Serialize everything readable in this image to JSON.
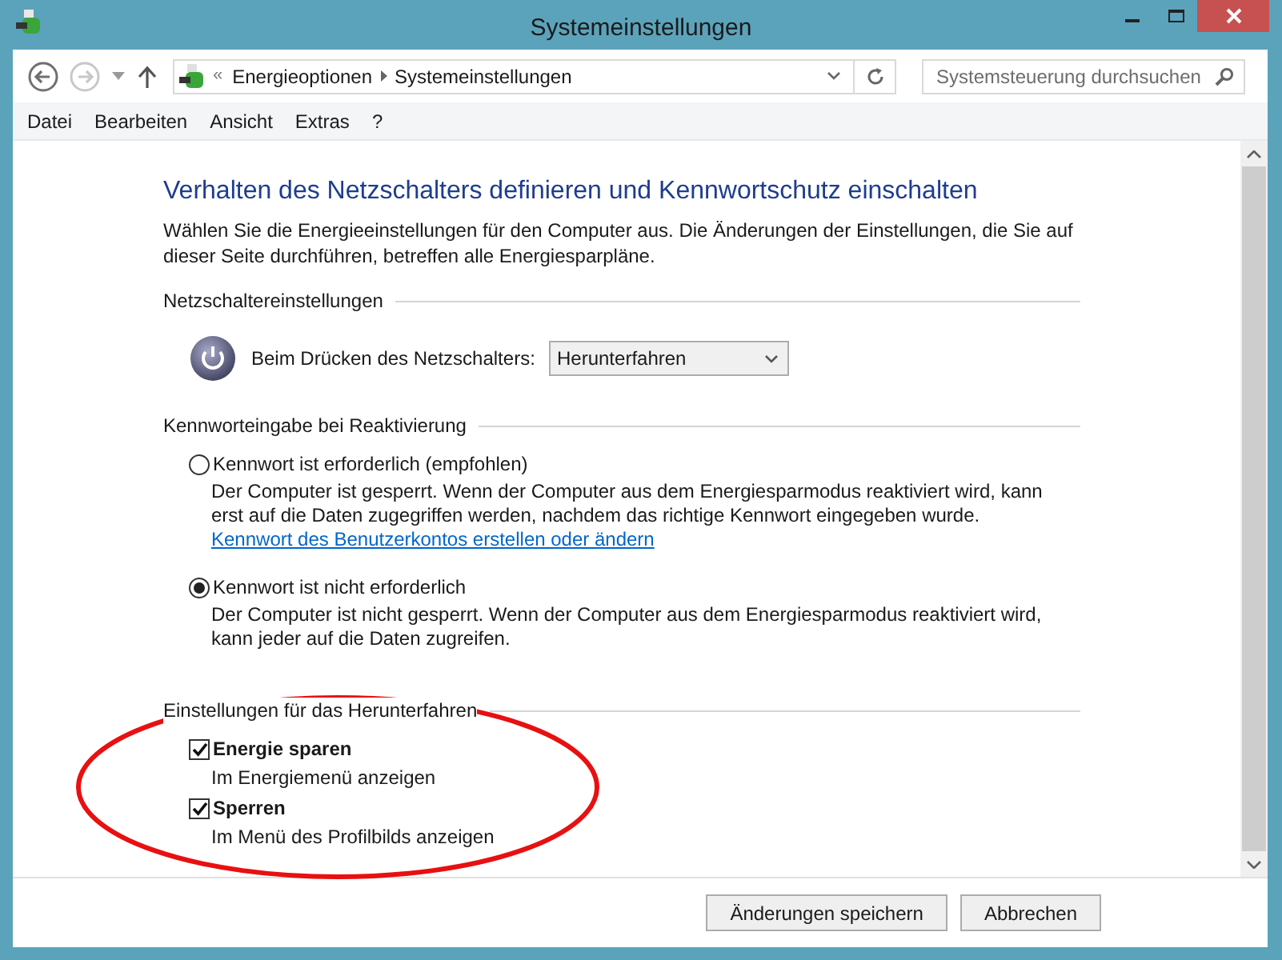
{
  "window": {
    "title": "Systemeinstellungen"
  },
  "nav": {
    "back": {
      "disabled": false
    },
    "forward": {
      "disabled": true
    },
    "breadcrumbs": [
      "Energieoptionen",
      "Systemeinstellungen"
    ],
    "overflow": "«",
    "search": {
      "placeholder": "Systemsteuerung durchsuchen"
    }
  },
  "menu": [
    "Datei",
    "Bearbeiten",
    "Ansicht",
    "Extras",
    "?"
  ],
  "heading": "Verhalten des Netzschalters definieren und Kennwortschutz einschalten",
  "intro": "Wählen Sie die Energieeinstellungen für den Computer aus. Die Änderungen der Einstellungen, die Sie auf dieser Seite durchführen, betreffen alle Energiesparpläne.",
  "sections": [
    {
      "kind": "power",
      "title": "Netzschaltereinstellungen",
      "label": "Beim Drücken des Netzschalters:",
      "value": "Herunterfahren"
    },
    {
      "kind": "radios",
      "title": "Kennworteingabe bei Reaktivierung",
      "options": [
        {
          "label": "Kennwort ist erforderlich (empfohlen)",
          "selected": false,
          "description": "Der Computer ist gesperrt. Wenn der Computer aus dem Energiesparmodus reaktiviert wird, kann erst auf die Daten zugegriffen werden, nachdem das richtige Kennwort eingegeben wurde.",
          "link": "Kennwort des Benutzerkontos erstellen oder ändern"
        },
        {
          "label": "Kennwort ist nicht erforderlich",
          "selected": true,
          "description": "Der Computer ist nicht gesperrt. Wenn der Computer aus dem Energiesparmodus reaktiviert wird, kann jeder auf die Daten zugreifen."
        }
      ]
    },
    {
      "kind": "checkboxes",
      "title": "Einstellungen für das Herunterfahren",
      "options": [
        {
          "label": "Energie sparen",
          "checked": true,
          "description": "Im Energiemenü anzeigen"
        },
        {
          "label": "Sperren",
          "checked": true,
          "description": "Im Menü des Profilbilds anzeigen"
        }
      ]
    }
  ],
  "buttons": [
    "Änderungen speichern",
    "Abbrechen"
  ]
}
